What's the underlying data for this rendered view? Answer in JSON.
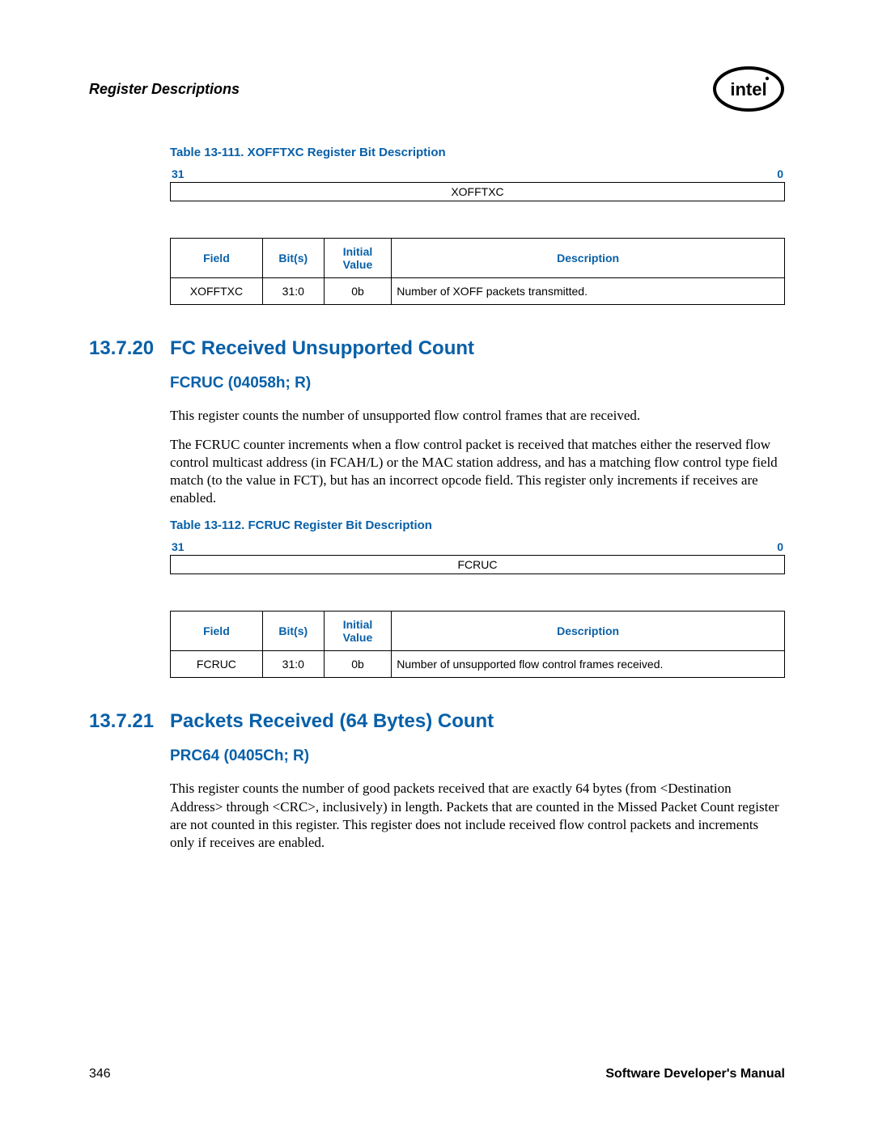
{
  "header": {
    "title": "Register Descriptions"
  },
  "table111": {
    "caption": "Table 13-111. XOFFTXC Register Bit Description",
    "bit_hi": "31",
    "bit_lo": "0",
    "field_name": "XOFFTXC",
    "cols": {
      "field": "Field",
      "bits": "Bit(s)",
      "init": "Initial Value",
      "desc": "Description"
    },
    "row": {
      "field": "XOFFTXC",
      "bits": "31:0",
      "init": "0b",
      "desc": "Number of XOFF packets transmitted."
    }
  },
  "sec20": {
    "num": "13.7.20",
    "title": "FC Received Unsupported Count",
    "sub": "FCRUC (04058h; R)",
    "p1": "This register counts the number of unsupported flow control frames that are received.",
    "p2": "The FCRUC counter increments when a flow control packet is received that matches either the reserved flow control multicast address (in FCAH/L) or the MAC station address, and has a matching flow control type field match (to the value in FCT), but has an incorrect opcode field. This register only increments if receives are enabled."
  },
  "table112": {
    "caption": "Table 13-112. FCRUC Register Bit Description",
    "bit_hi": "31",
    "bit_lo": "0",
    "field_name": "FCRUC",
    "cols": {
      "field": "Field",
      "bits": "Bit(s)",
      "init": "Initial Value",
      "desc": "Description"
    },
    "row": {
      "field": "FCRUC",
      "bits": "31:0",
      "init": "0b",
      "desc": "Number of unsupported flow control frames received."
    }
  },
  "sec21": {
    "num": "13.7.21",
    "title": "Packets Received (64 Bytes) Count",
    "sub": "PRC64 (0405Ch; R)",
    "p1": "This register counts the number of good packets received that are exactly 64 bytes (from <Destination Address> through <CRC>, inclusively) in length. Packets that are counted in the Missed Packet Count register are not counted in this register. This register does not include received flow control packets and increments only if receives are enabled."
  },
  "footer": {
    "page": "346",
    "manual": "Software Developer's Manual"
  }
}
